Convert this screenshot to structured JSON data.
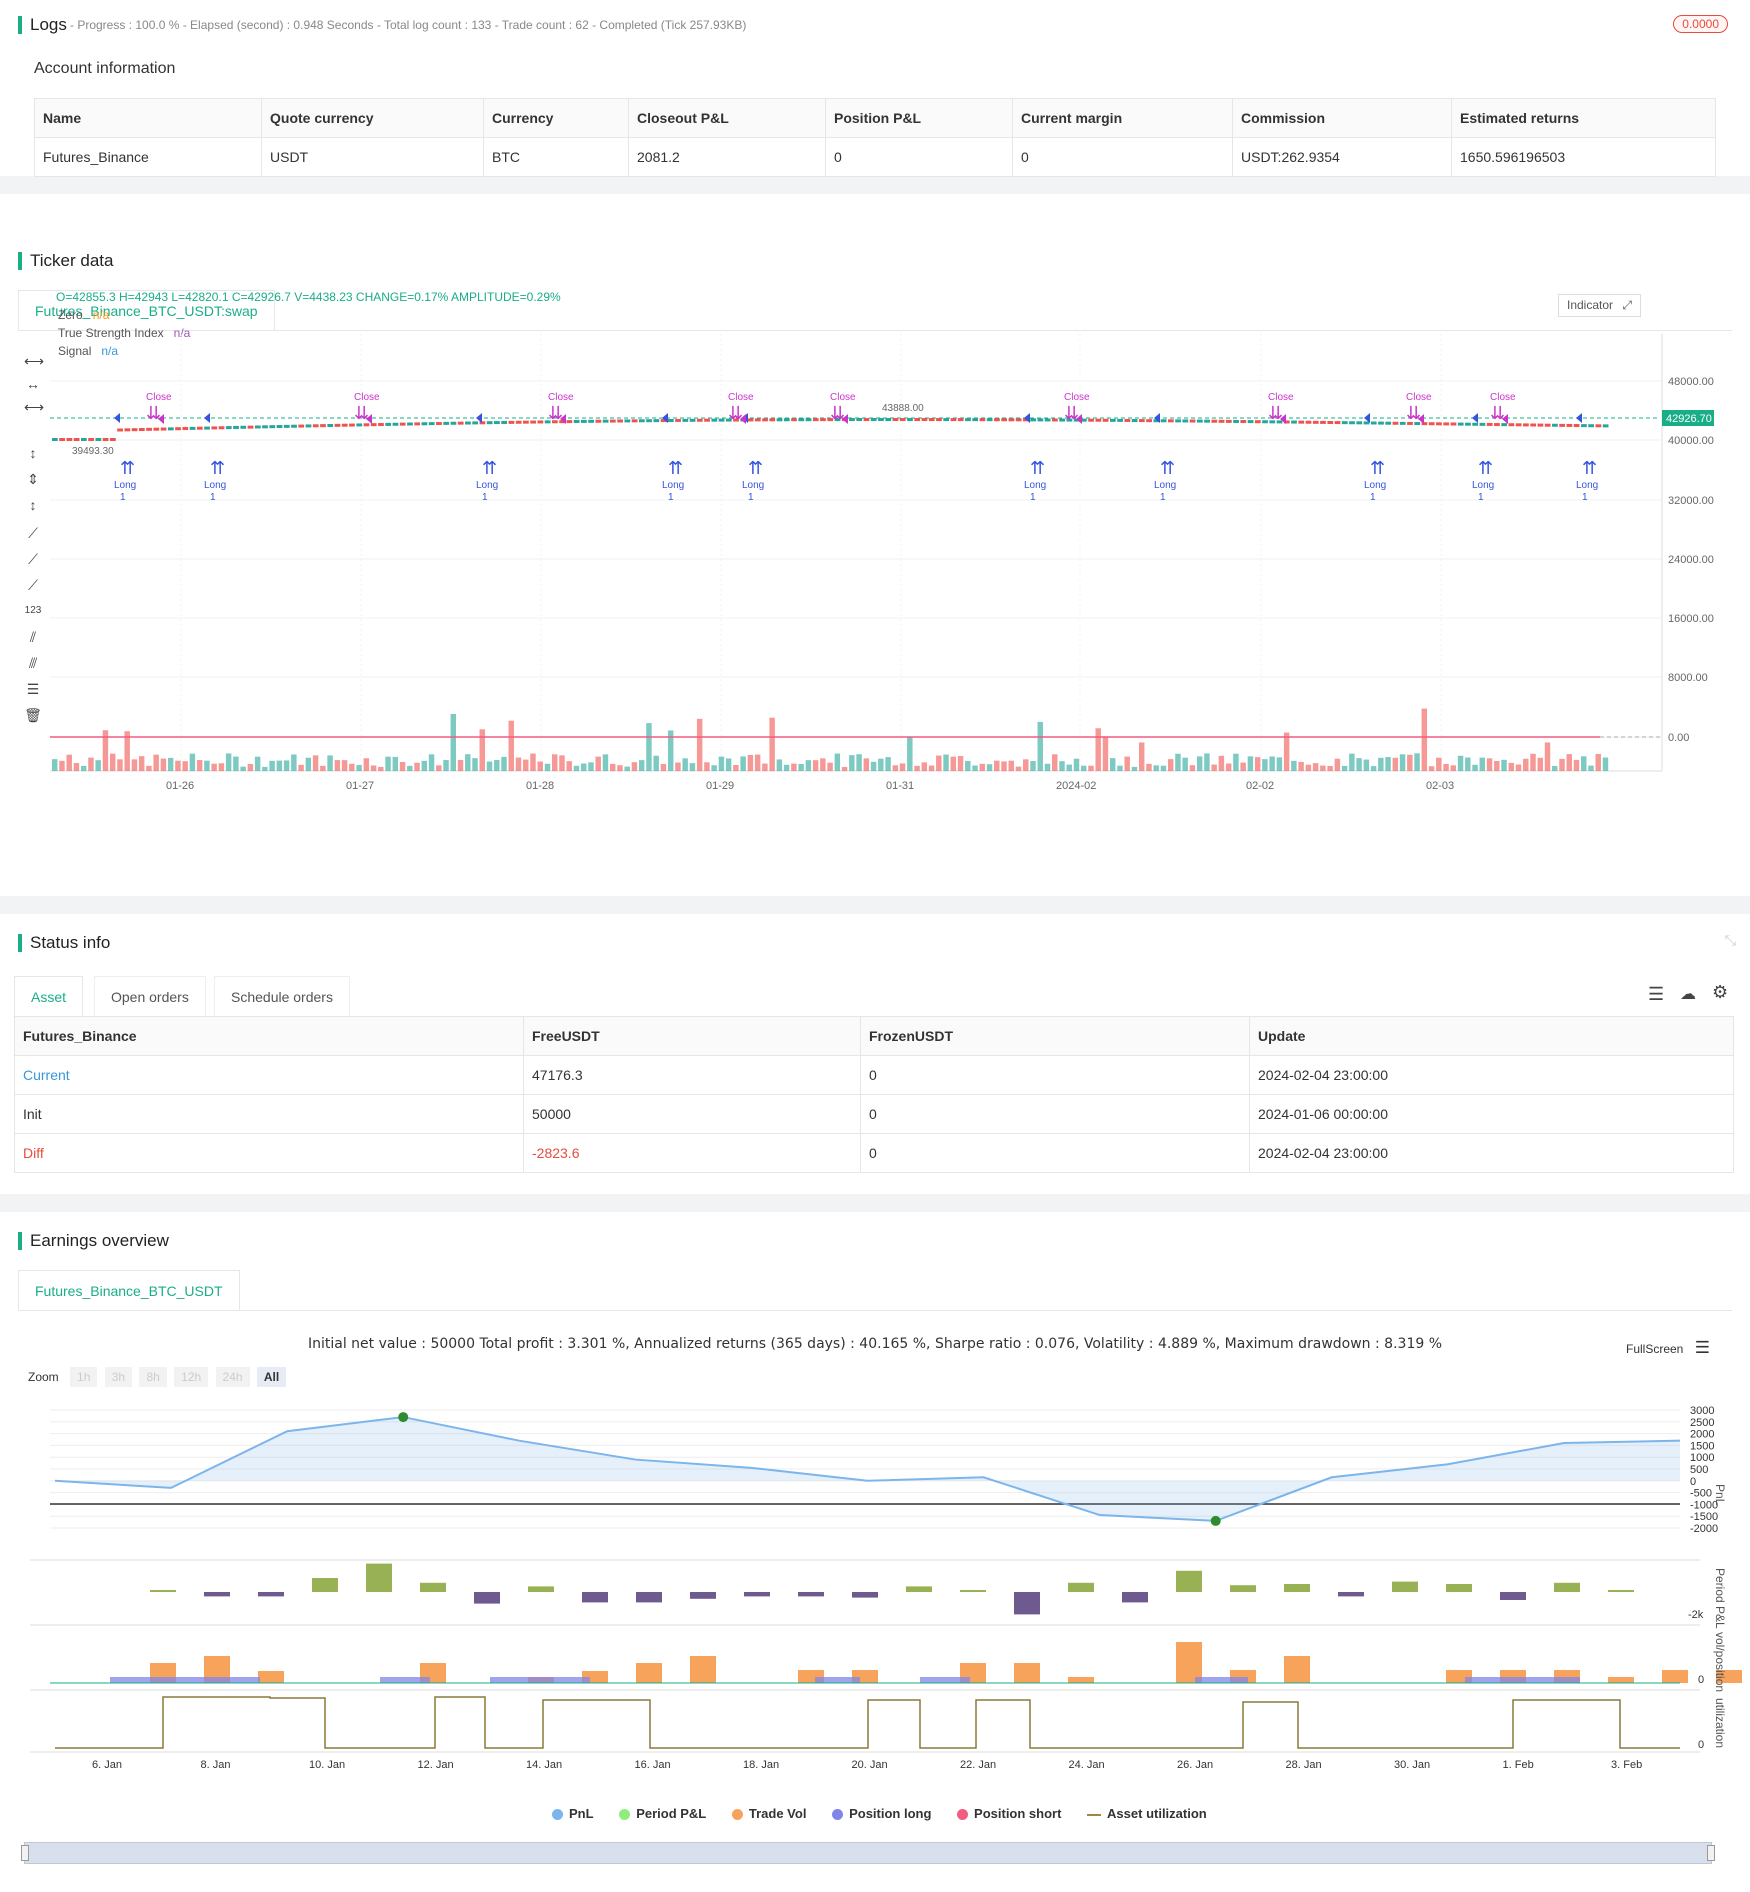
{
  "logs": {
    "title": "Logs",
    "summary": "- Progress : 100.0 % - Elapsed (second) : 0.948  Seconds - Total log count : 133 - Trade count : 62 - Completed (Tick 257.93KB)",
    "badge": "0.0000",
    "account_title": "Account information",
    "columns": [
      "Name",
      "Quote currency",
      "Currency",
      "Closeout P&L",
      "Position P&L",
      "Current margin",
      "Commission",
      "Estimated returns"
    ],
    "row": [
      "Futures_Binance",
      "USDT",
      "BTC",
      "2081.2",
      "0",
      "0",
      "USDT:262.9354",
      "1650.596196503"
    ]
  },
  "ticker": {
    "title": "Ticker data",
    "tab": "Futures_Binance_BTC_USDT:swap",
    "ohlc": "O=42855.3 H=42943 L=42820.1 C=42926.7 V=4438.23 CHANGE=0.17% AMPLITUDE=0.29%",
    "legend": [
      {
        "label": "Zero",
        "value": "n/a",
        "color": "#f39c12"
      },
      {
        "label": "True Strength Index",
        "value": "n/a",
        "color": "#9b59b6"
      },
      {
        "label": "Signal",
        "value": "n/a",
        "color": "#3498db"
      }
    ],
    "indicator_btn": "Indicator",
    "price_label": "42926.70",
    "high_label": "43888.00",
    "low_label": "39493.30",
    "y_ticks": [
      "48000.00",
      "40000.00",
      "32000.00",
      "24000.00",
      "16000.00",
      "8000.00",
      "0.00"
    ],
    "x_ticks": [
      "01-26",
      "01-27",
      "01-28",
      "01-29",
      "01-31",
      "2024-02",
      "02-02",
      "02-03"
    ],
    "long_label": "Long",
    "close_label": "Close",
    "qty_label": "1"
  },
  "status": {
    "title": "Status info",
    "tabs": [
      "Asset",
      "Open orders",
      "Schedule orders"
    ],
    "columns": [
      "Futures_Binance",
      "FreeUSDT",
      "FrozenUSDT",
      "Update"
    ],
    "rows": [
      [
        "Current",
        "47176.3",
        "0",
        "2024-02-04 23:00:00"
      ],
      [
        "Init",
        "50000",
        "0",
        "2024-01-06 00:00:00"
      ],
      [
        "Diff",
        "-2823.6",
        "0",
        "2024-02-04 23:00:00"
      ]
    ]
  },
  "earnings": {
    "title": "Earnings overview",
    "tab": "Futures_Binance_BTC_USDT",
    "summary": "Initial net value : 50000 Total profit : 3.301 %, Annualized returns (365 days) : 40.165 %, Sharpe ratio : 0.076, Volatility : 4.889 %, Maximum drawdown : 8.319 %",
    "fullscreen": "FullScreen",
    "zoom_label": "Zoom",
    "zoom_buttons": [
      "1h",
      "3h",
      "8h",
      "12h",
      "24h",
      "All"
    ],
    "pnl_ticks": [
      "3000",
      "2500",
      "2000",
      "1500",
      "1000",
      "500",
      "0",
      "-500",
      "-1000",
      "-1500",
      "-2000"
    ],
    "axis_titles": [
      "PnL",
      "Period P&L",
      "vol/position",
      "utilization"
    ],
    "period_tick": "-2k",
    "zero_tick": "0",
    "x_ticks": [
      "6. Jan",
      "8. Jan",
      "10. Jan",
      "12. Jan",
      "14. Jan",
      "16. Jan",
      "18. Jan",
      "20. Jan",
      "22. Jan",
      "24. Jan",
      "26. Jan",
      "28. Jan",
      "30. Jan",
      "1. Feb",
      "3. Feb"
    ],
    "legend": [
      {
        "label": "PnL",
        "color": "#7cb5ec"
      },
      {
        "label": "Period P&L",
        "color": "#90ed7d"
      },
      {
        "label": "Trade Vol",
        "color": "#f7a35c"
      },
      {
        "label": "Position long",
        "color": "#8085e9"
      },
      {
        "label": "Position short",
        "color": "#f15c80"
      },
      {
        "label": "Asset utilization",
        "color": "#a0883a"
      }
    ]
  },
  "chart_data": {
    "type": "line",
    "x": [
      "6. Jan",
      "8. Jan",
      "10. Jan",
      "12. Jan",
      "14. Jan",
      "16. Jan",
      "18. Jan",
      "20. Jan",
      "22. Jan",
      "24. Jan",
      "26. Jan",
      "28. Jan",
      "30. Jan",
      "1. Feb",
      "3. Feb"
    ],
    "series": [
      {
        "name": "PnL",
        "values": [
          0,
          -300,
          2100,
          2700,
          1700,
          900,
          550,
          0,
          150,
          -1450,
          -1700,
          150,
          700,
          1600,
          1700
        ]
      }
    ],
    "ylim": [
      -2000,
      3000
    ]
  }
}
